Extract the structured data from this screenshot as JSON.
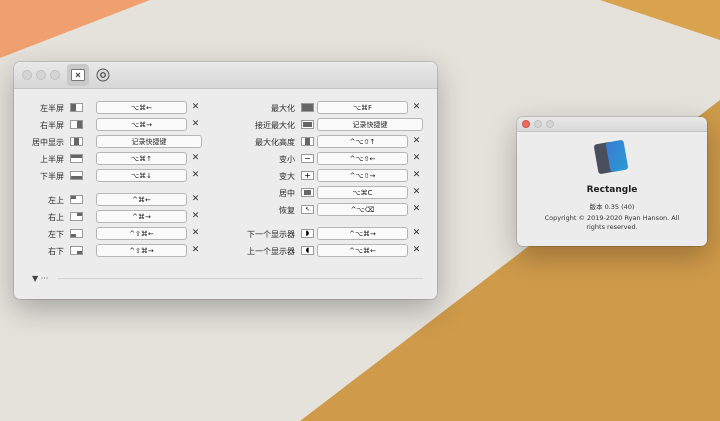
{
  "left_rows": [
    {
      "label": "左半屏",
      "shortcut": "⌥⌘←",
      "clear": "✕",
      "icon": "left-half"
    },
    {
      "label": "右半屏",
      "shortcut": "⌥⌘→",
      "clear": "✕",
      "icon": "right-half"
    },
    {
      "label": "居中显示",
      "shortcut": "记录快捷键",
      "clear": "",
      "icon": "center-half"
    },
    {
      "label": "上半屏",
      "shortcut": "⌥⌘↑",
      "clear": "✕",
      "icon": "top-half"
    },
    {
      "label": "下半屏",
      "shortcut": "⌥⌘↓",
      "clear": "✕",
      "icon": "bottom-half"
    },
    {
      "label": "左上",
      "shortcut": "^⌘←",
      "clear": "✕",
      "icon": "top-left"
    },
    {
      "label": "右上",
      "shortcut": "^⌘→",
      "clear": "✕",
      "icon": "top-right"
    },
    {
      "label": "左下",
      "shortcut": "^⇧⌘←",
      "clear": "✕",
      "icon": "bottom-left"
    },
    {
      "label": "右下",
      "shortcut": "^⇧⌘→",
      "clear": "✕",
      "icon": "bottom-right"
    }
  ],
  "right_rows": [
    {
      "label": "最大化",
      "shortcut": "⌥⌘F",
      "clear": "✕",
      "icon": "maximize"
    },
    {
      "label": "接近最大化",
      "shortcut": "记录快捷键",
      "clear": "",
      "icon": "almost-maximize"
    },
    {
      "label": "最大化高度",
      "shortcut": "^⌥⇧↑",
      "clear": "✕",
      "icon": "maximize-height"
    },
    {
      "label": "变小",
      "shortcut": "^⌥⇧←",
      "clear": "✕",
      "icon": "smaller"
    },
    {
      "label": "变大",
      "shortcut": "^⌥⇧→",
      "clear": "✕",
      "icon": "larger"
    },
    {
      "label": "居中",
      "shortcut": "⌥⌘C",
      "clear": "✕",
      "icon": "center"
    },
    {
      "label": "恢复",
      "shortcut": "^⌥⌫",
      "clear": "✕",
      "icon": "restore"
    },
    {
      "label": "下一个显示器",
      "shortcut": "^⌥⌘→",
      "clear": "✕",
      "icon": "next-display"
    },
    {
      "label": "上一个显示器",
      "shortcut": "^⌥⌘←",
      "clear": "✕",
      "icon": "previous-display"
    }
  ],
  "footer": {
    "expand": "▼ ···"
  },
  "about": {
    "app_name": "Rectangle",
    "version": "版本 0.35 (40)",
    "copyright": "Copyright © 2019-2020 Ryan Hanson. All rights reserved."
  },
  "colors": {
    "wallpaper_orange": "#f0a06e",
    "wallpaper_gold": "#cf9a4a",
    "close_red": "#ec6a5e"
  }
}
